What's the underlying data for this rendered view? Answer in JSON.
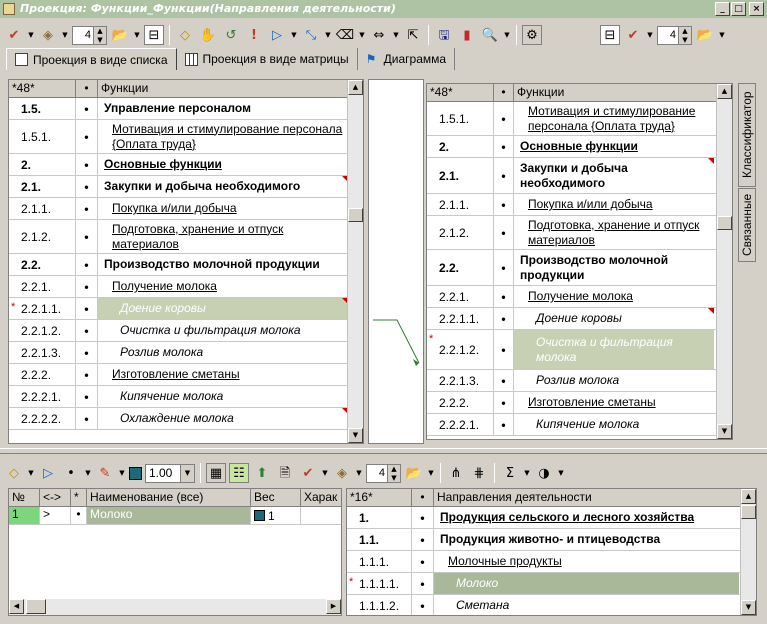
{
  "window": {
    "title": "Проекция: Функции_Функции(Направления деятельности)",
    "min": "_",
    "max": "□",
    "close": "×"
  },
  "toolbar": {
    "zoom_value": "4",
    "bottom_zoom_value": "4",
    "size_value": "1.00"
  },
  "tabs": [
    {
      "label": "Проекция в виде списка"
    },
    {
      "label": "Проекция в виде матрицы"
    },
    {
      "label": "Диаграмма"
    }
  ],
  "left_grid": {
    "header": {
      "num": "*48*",
      "dot": "•",
      "name": "Функции"
    },
    "rows": [
      {
        "num": "1.5.",
        "name": "Управление персоналом",
        "style": "b"
      },
      {
        "num": "1.5.1.",
        "name": "Мотивация и стимулирование персонала {Оплата труда}",
        "style": "u"
      },
      {
        "num": "2.",
        "name": "Основные функции",
        "style": "bu"
      },
      {
        "num": "2.1.",
        "name": "Закупки и добыча необходимого",
        "style": "b"
      },
      {
        "num": "2.1.1.",
        "name": "Покупка и/или добыча",
        "style": "u"
      },
      {
        "num": "2.1.2.",
        "name": "Подготовка, хранение и отпуск материалов",
        "style": "u"
      },
      {
        "num": "2.2.",
        "name": "Производство молочной продукции",
        "style": "b"
      },
      {
        "num": "2.2.1.",
        "name": "Получение молока",
        "style": "u"
      },
      {
        "num": "2.2.1.1.",
        "name": "Доение коровы",
        "style": "i",
        "mark": "*"
      },
      {
        "num": "2.2.1.2.",
        "name": "Очистка и фильтрация молока",
        "style": "i"
      },
      {
        "num": "2.2.1.3.",
        "name": "Розлив молока",
        "style": "i"
      },
      {
        "num": "2.2.2.",
        "name": "Изготовление сметаны",
        "style": "u"
      },
      {
        "num": "2.2.2.1.",
        "name": "Кипячение молока",
        "style": "i"
      },
      {
        "num": "2.2.2.2.",
        "name": "Охлаждение молока",
        "style": "i"
      }
    ]
  },
  "right_grid": {
    "header": {
      "num": "*48*",
      "dot": "•",
      "name": "Функции"
    },
    "rows": [
      {
        "num": "1.5.1.",
        "name": "Мотивация и стимулирование персонала {Оплата труда}",
        "style": "u"
      },
      {
        "num": "2.",
        "name": "Основные функции",
        "style": "bu"
      },
      {
        "num": "2.1.",
        "name": "Закупки и добыча необходимого",
        "style": "b"
      },
      {
        "num": "2.1.1.",
        "name": "Покупка и/или добыча",
        "style": "u"
      },
      {
        "num": "2.1.2.",
        "name": "Подготовка, хранение и отпуск материалов",
        "style": "u"
      },
      {
        "num": "2.2.",
        "name": "Производство молочной продукции",
        "style": "b"
      },
      {
        "num": "2.2.1.",
        "name": "Получение молока",
        "style": "u"
      },
      {
        "num": "2.2.1.1.",
        "name": "Доение коровы",
        "style": "i"
      },
      {
        "num": "2.2.1.2.",
        "name": "Очистка и фильтрация молока",
        "style": "i",
        "mark": "*"
      },
      {
        "num": "2.2.1.3.",
        "name": "Розлив молока",
        "style": "i"
      },
      {
        "num": "2.2.2.",
        "name": "Изготовление сметаны",
        "style": "u"
      },
      {
        "num": "2.2.2.1.",
        "name": "Кипячение молока",
        "style": "i"
      }
    ]
  },
  "side_tabs": {
    "classifier": "Классификатор",
    "linked": "Связанные"
  },
  "bottom_left_grid": {
    "header": {
      "no": "№",
      "arrows": "<->",
      "star": "*",
      "name": "Наименование (все)",
      "weight": "Вес",
      "char": "Харак"
    },
    "row": {
      "no": "1",
      "arrows": ">",
      "star": "•",
      "name": "Молоко",
      "weight": "1"
    }
  },
  "bottom_right_grid": {
    "header": {
      "num": "*16*",
      "dot": "•",
      "name": "Направления деятельности"
    },
    "rows": [
      {
        "num": "1.",
        "name": "Продукция сельского и лесного хозяйства",
        "style": "bu"
      },
      {
        "num": "1.1.",
        "name": "Продукция животно- и птицеводства",
        "style": "b"
      },
      {
        "num": "1.1.1.",
        "name": "Молочные продукты",
        "style": "u"
      },
      {
        "num": "1.1.1.1.",
        "name": "Молоко",
        "style": "i",
        "mark": "*"
      },
      {
        "num": "1.1.1.2.",
        "name": "Сметана",
        "style": "i"
      }
    ]
  }
}
